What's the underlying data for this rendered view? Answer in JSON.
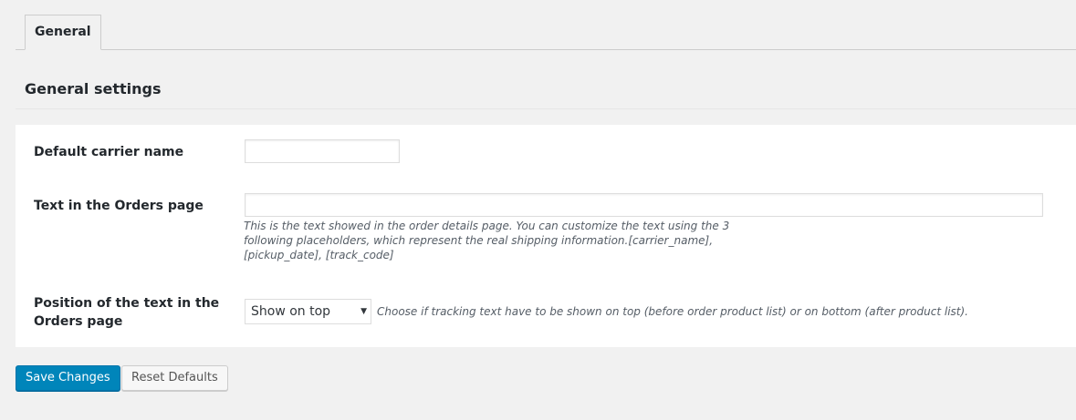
{
  "tabs": [
    {
      "label": "General",
      "active": true
    }
  ],
  "section": {
    "title": "General settings"
  },
  "fields": {
    "carrier_name": {
      "label": "Default carrier name",
      "value": ""
    },
    "orders_text": {
      "label": "Text in the Orders page",
      "value": "",
      "description_lines": [
        "This is the text showed in the order details page. You can customize the text using the 3",
        "following placeholders, which represent the real shipping information.[carrier_name],",
        "[pickup_date], [track_code]"
      ]
    },
    "position": {
      "label_lines": [
        "Position of the text in the",
        "Orders page"
      ],
      "selected": "Show on top",
      "description": "Choose if tracking text have to be shown on top (before order product list) or on bottom (after product list)."
    }
  },
  "buttons": {
    "save": "Save Changes",
    "reset": "Reset Defaults"
  },
  "colors": {
    "primary": "#0085ba",
    "background": "#f1f1f1",
    "panel": "#ffffff"
  },
  "icons": {
    "select_arrow": "caret-down-icon"
  }
}
